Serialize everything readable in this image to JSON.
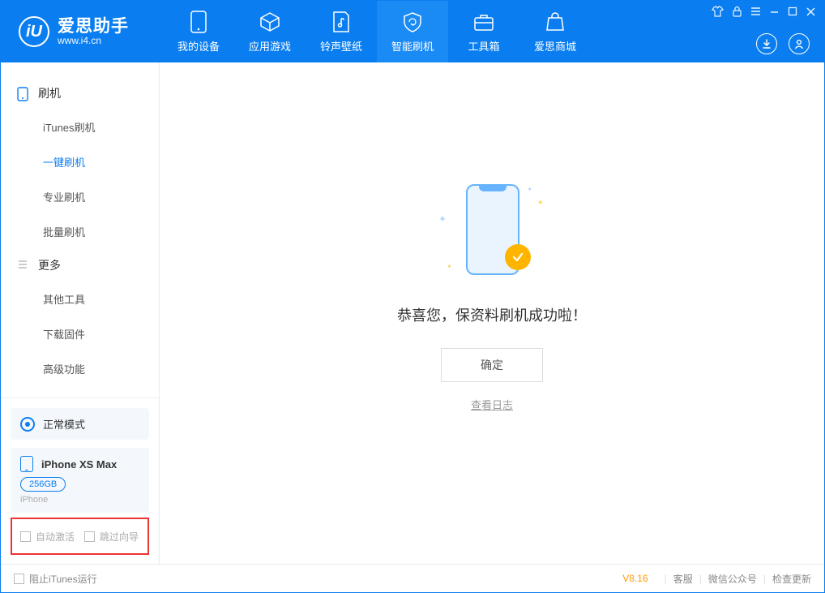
{
  "app": {
    "title": "爱思助手",
    "url": "www.i4.cn"
  },
  "topTabs": [
    {
      "label": "我的设备"
    },
    {
      "label": "应用游戏"
    },
    {
      "label": "铃声壁纸"
    },
    {
      "label": "智能刷机"
    },
    {
      "label": "工具箱"
    },
    {
      "label": "爱思商城"
    }
  ],
  "sidebar": {
    "cat1": "刷机",
    "items1": [
      {
        "label": "iTunes刷机"
      },
      {
        "label": "一键刷机"
      },
      {
        "label": "专业刷机"
      },
      {
        "label": "批量刷机"
      }
    ],
    "cat2": "更多",
    "items2": [
      {
        "label": "其他工具"
      },
      {
        "label": "下载固件"
      },
      {
        "label": "高级功能"
      }
    ]
  },
  "device": {
    "mode": "正常模式",
    "name": "iPhone XS Max",
    "storage": "256GB",
    "type": "iPhone"
  },
  "options": {
    "auto_activate": "自动激活",
    "skip_guide": "跳过向导"
  },
  "main": {
    "success": "恭喜您，保资料刷机成功啦！",
    "ok": "确定",
    "view_log": "查看日志"
  },
  "status": {
    "block_itunes": "阻止iTunes运行",
    "version": "V8.16",
    "support": "客服",
    "wechat": "微信公众号",
    "update": "检查更新"
  }
}
